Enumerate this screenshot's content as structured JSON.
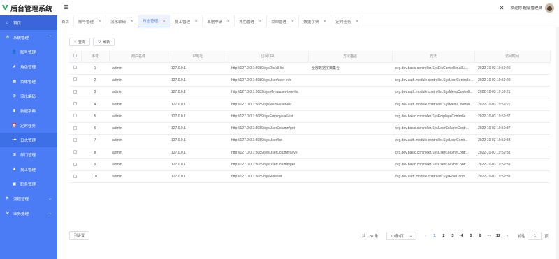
{
  "app": {
    "title": "后台管理系统"
  },
  "header": {
    "welcome": "欢迎你 超级管理员"
  },
  "sidebar": {
    "home": "首页",
    "system": "系统管理",
    "items": [
      {
        "label": "账号管理",
        "icon": "user-icon"
      },
      {
        "label": "角色管理",
        "icon": "star-icon"
      },
      {
        "label": "菜单管理",
        "icon": "grid-icon"
      },
      {
        "label": "流水编码",
        "icon": "plus-icon"
      },
      {
        "label": "数据字典",
        "icon": "chart-icon"
      },
      {
        "label": "定时任务",
        "icon": "alarm-icon"
      },
      {
        "label": "日志管理",
        "icon": "dots-icon"
      },
      {
        "label": "部门管理",
        "icon": "tree-icon"
      },
      {
        "label": "员工管理",
        "icon": "person-icon"
      },
      {
        "label": "职务管理",
        "icon": "briefcase-icon"
      }
    ],
    "process": "流程管理",
    "business": "业务处理"
  },
  "tabs": [
    {
      "label": "首页",
      "close": false
    },
    {
      "label": "账号管理",
      "close": true
    },
    {
      "label": "流水编码",
      "close": true
    },
    {
      "label": "日志管理",
      "close": true,
      "active": true
    },
    {
      "label": "员工管理",
      "close": true
    },
    {
      "label": "单据申请",
      "close": true
    },
    {
      "label": "角色管理",
      "close": true
    },
    {
      "label": "菜单管理",
      "close": true
    },
    {
      "label": "数据字典",
      "close": true
    },
    {
      "label": "定时任务",
      "close": true
    }
  ],
  "toolbar": {
    "query": "查询",
    "refresh": "刷新"
  },
  "table": {
    "headers": [
      "",
      "序号",
      "用户名称",
      "IP地址",
      "访问URL",
      "方法描述",
      "方法",
      "访问时间"
    ],
    "rows": [
      [
        "1",
        "admin",
        "127.0.0.1",
        "http://127.0.0.1:8089/sysDic/all-list",
        "全部数据字典集合",
        "org.dev.basic.controller.SysDicController.allLi...",
        "2022-10-03 19:59:20"
      ],
      [
        "2",
        "admin",
        "127.0.0.1",
        "http://127.0.0.1:8089/sysUser/user-info",
        "",
        "org.dev.auth.module.controller.SysUserControlle...",
        "2022-10-03 19:59:20"
      ],
      [
        "3",
        "admin",
        "127.0.0.1",
        "http://127.0.0.1:8089/sysMenu/user-tree-list",
        "",
        "org.dev.auth.module.controller.SysMenuControll...",
        "2022-10-03 19:59:21"
      ],
      [
        "4",
        "admin",
        "127.0.0.1",
        "http://127.0.0.1:8089/sysMenu/user-list",
        "",
        "org.dev.auth.module.controller.SysMenuControll...",
        "2022-10-03 19:59:21"
      ],
      [
        "5",
        "admin",
        "127.0.0.1",
        "http://127.0.0.1:8089/sysEmploye/all-list",
        "",
        "org.dev.basic.controller.SysEmployeControlle...",
        "2022-10-03 19:59:37"
      ],
      [
        "6",
        "admin",
        "127.0.0.1",
        "http://127.0.0.1:8089/sysUserColumn/get",
        "",
        "org.dev.basic.controller.SysUserColumnContr...",
        "2022-10-03 19:59:37"
      ],
      [
        "7",
        "admin",
        "127.0.0.1",
        "http://127.0.0.1:8089/sysUser/list",
        "",
        "org.dev.auth.module.controller.SysUserContr...",
        "2022-10-03 19:59:38"
      ],
      [
        "8",
        "admin",
        "127.0.0.1",
        "http://127.0.0.1:8089/sysUserColumn/save",
        "",
        "org.dev.basic.controller.SysUserColumnContr...",
        "2022-10-03 19:59:38"
      ],
      [
        "9",
        "admin",
        "127.0.0.1",
        "http://127.0.0.1:8089/sysUserColumn/get",
        "",
        "org.dev.basic.controller.SysUserColumnContr...",
        "2022-10-03 19:59:39"
      ],
      [
        "10",
        "admin",
        "127.0.0.1",
        "http://127.0.0.1:8089/sysRole/list",
        "",
        "org.dev.auth.module.controller.SysRoleContr...",
        "2022-10-03 19:59:39"
      ]
    ]
  },
  "footer": {
    "col_settings": "列设置",
    "total": "共 120 条",
    "page_size": "10条/页",
    "pages": [
      "1",
      "2",
      "3",
      "4",
      "5",
      "6",
      "···",
      "12"
    ],
    "goto_label": "前往",
    "goto_value": "1",
    "page_unit": "页"
  },
  "colors": {
    "accent": "#4b7bf5",
    "sidebar": "#4b7bf5"
  }
}
